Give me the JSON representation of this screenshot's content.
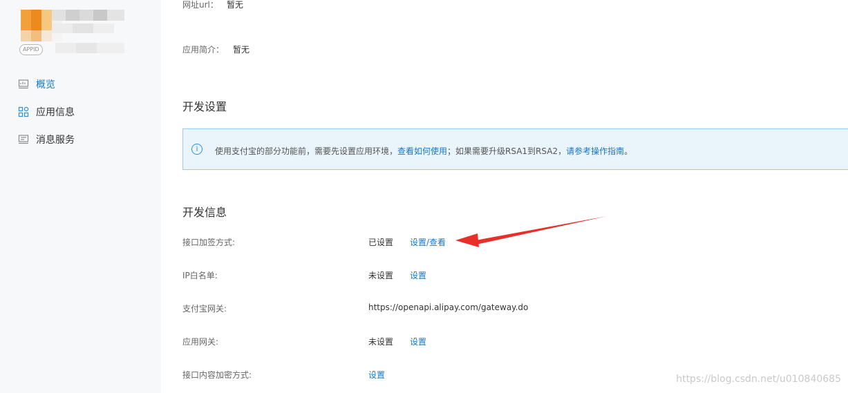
{
  "sidebar": {
    "appid_badge": "APPID",
    "items": [
      {
        "label": "概览",
        "icon": "monitor-chart-icon"
      },
      {
        "label": "应用信息",
        "icon": "grid-apps-icon"
      },
      {
        "label": "消息服务",
        "icon": "monitor-message-icon"
      }
    ],
    "active_color": "#1677c9"
  },
  "basic_info": {
    "url_label": "网址url：",
    "url_value": "暂无",
    "desc_label": "应用简介：",
    "desc_value": "暂无"
  },
  "dev_settings": {
    "title": "开发设置",
    "notice": {
      "icon": "info-circle-icon",
      "text_before": "使用支付宝的部分功能前，需要先设置应用环境，",
      "link1": "查看如何使用",
      "text_middle": "；如果需要升级RSA1到RSA2，",
      "link2": "请参考操作指南",
      "text_after": "。"
    }
  },
  "dev_info": {
    "title": "开发信息",
    "rows": [
      {
        "label": "接口加签方式:",
        "status": "已设置",
        "action": "设置/查看"
      },
      {
        "label": "IP白名单:",
        "status": "未设置",
        "action": "设置"
      },
      {
        "label": "支付宝网关:",
        "status": "https://openapi.alipay.com/gateway.do",
        "action": ""
      },
      {
        "label": "应用网关:",
        "status": "未设置",
        "action": "设置"
      },
      {
        "label": "接口内容加密方式:",
        "status": "",
        "action": "设置"
      }
    ]
  },
  "annotation": {
    "arrow_color": "#e8302b"
  },
  "watermark": "https://blog.csdn.net/u010840685"
}
